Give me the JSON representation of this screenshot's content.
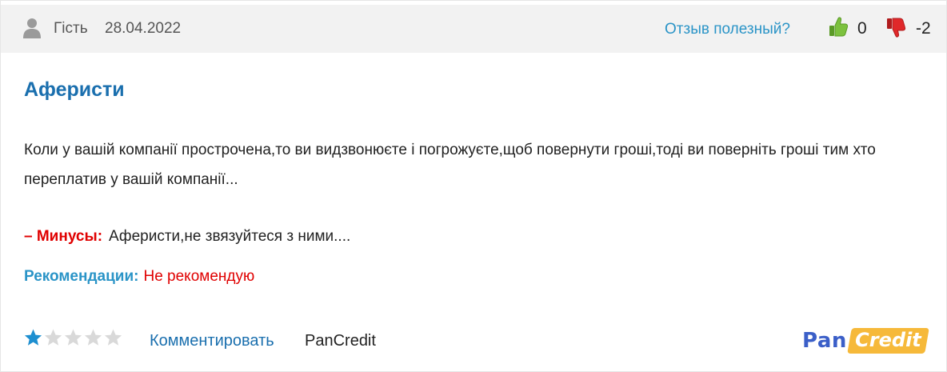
{
  "header": {
    "author": "Гість",
    "date": "28.04.2022",
    "helpful_question": "Отзыв полезный?",
    "likes": "0",
    "dislikes": "-2"
  },
  "review": {
    "title": "Аферисти",
    "body": "Коли у вашій компанії прострочена,то ви видзвонюєте  і погрожуєте,щоб повернути гроші,тоді ви поверніть гроші тим хто переплатив у вашій компанії...",
    "cons_label": "– Минусы:",
    "cons_text": "Аферисти,не звязуйтеся з ними....",
    "recommend_label": "Рекомендации:",
    "recommend_value": "Не рекомендую"
  },
  "footer": {
    "rating": 1,
    "rating_max": 5,
    "comment_link": "Комментировать",
    "brand_name": "PanCredit"
  },
  "logo": {
    "pan": "Pan",
    "credit": "Credit"
  },
  "colors": {
    "link_blue": "#2a94c7",
    "title_blue": "#1a6fae",
    "negative_red": "#e00000",
    "star_active": "#1e8fd0",
    "star_inactive": "#d9d9d9",
    "thumb_up": "#7cc13e",
    "thumb_down": "#e0282a"
  }
}
